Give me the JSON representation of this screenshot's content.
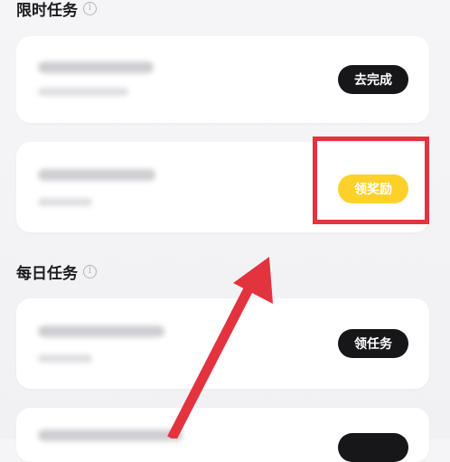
{
  "sections": {
    "limited": {
      "title": "限时任务",
      "info_icon": "info-icon"
    },
    "daily": {
      "title": "每日任务",
      "info_icon": "info-icon"
    }
  },
  "tasks": {
    "limited_1": {
      "button_label": "去完成"
    },
    "limited_2": {
      "button_label": "领奖励"
    },
    "daily_1": {
      "button_label": "领任务"
    }
  },
  "colors": {
    "accent_dark": "#17171a",
    "reward_yellow": "#fdd12a",
    "annotation_red": "#e3333f"
  }
}
